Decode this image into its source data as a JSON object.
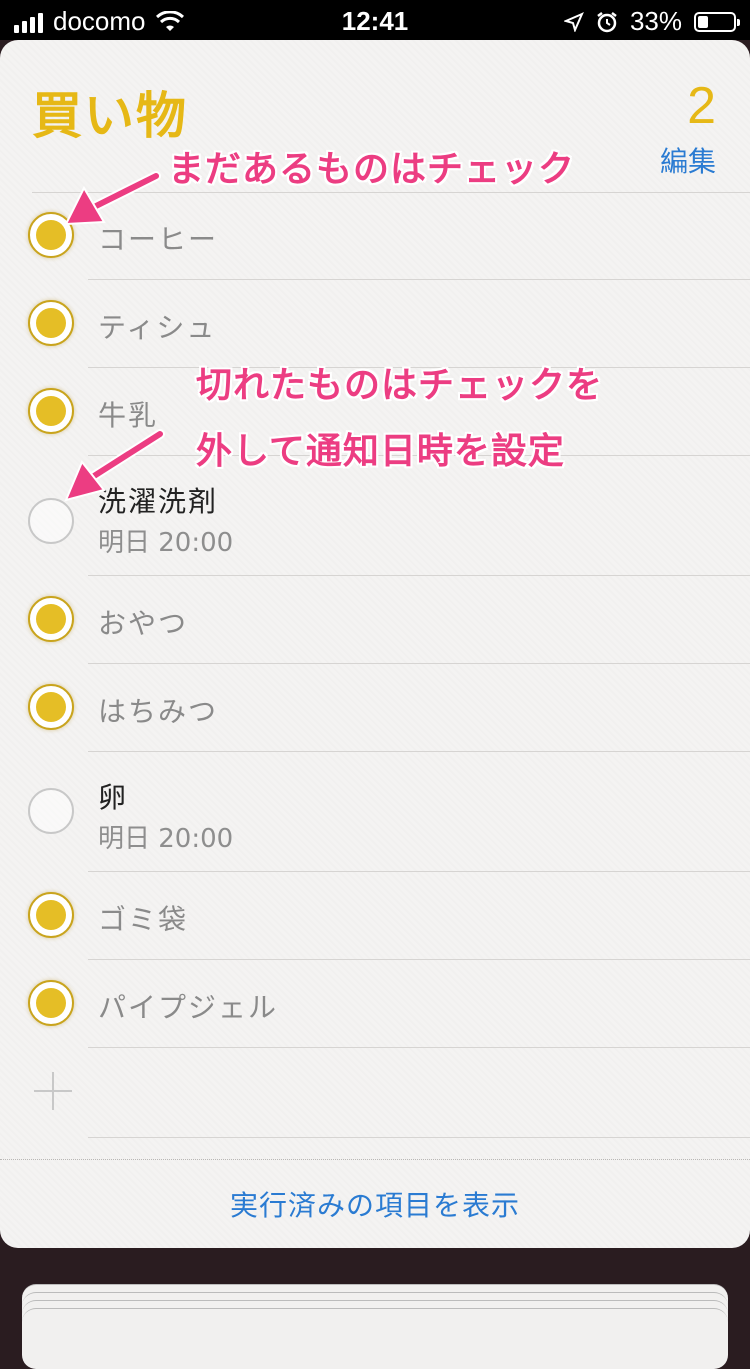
{
  "status": {
    "carrier": "docomo",
    "time": "12:41",
    "battery": "33%"
  },
  "list": {
    "title": "買い物",
    "count": "2",
    "edit_label": "編集",
    "items": [
      {
        "label": "コーヒー",
        "checked": true
      },
      {
        "label": "ティシュ",
        "checked": true
      },
      {
        "label": "牛乳",
        "checked": true
      },
      {
        "label": "洗濯洗剤",
        "checked": false,
        "sub": "明日 20:00"
      },
      {
        "label": "おやつ",
        "checked": true
      },
      {
        "label": "はちみつ",
        "checked": true
      },
      {
        "label": "卵",
        "checked": false,
        "sub": "明日 20:00"
      },
      {
        "label": "ゴミ袋",
        "checked": true
      },
      {
        "label": "パイプジェル",
        "checked": true
      }
    ],
    "show_completed_label": "実行済みの項目を表示"
  },
  "annotations": {
    "top": "まだあるものはチェック",
    "middle_line1": "切れたものはチェックを",
    "middle_line2": "外して通知日時を設定"
  },
  "colors": {
    "accent_yellow": "#e6b816",
    "link_blue": "#2a7bd2",
    "annotation_pink": "#ec3d82"
  }
}
